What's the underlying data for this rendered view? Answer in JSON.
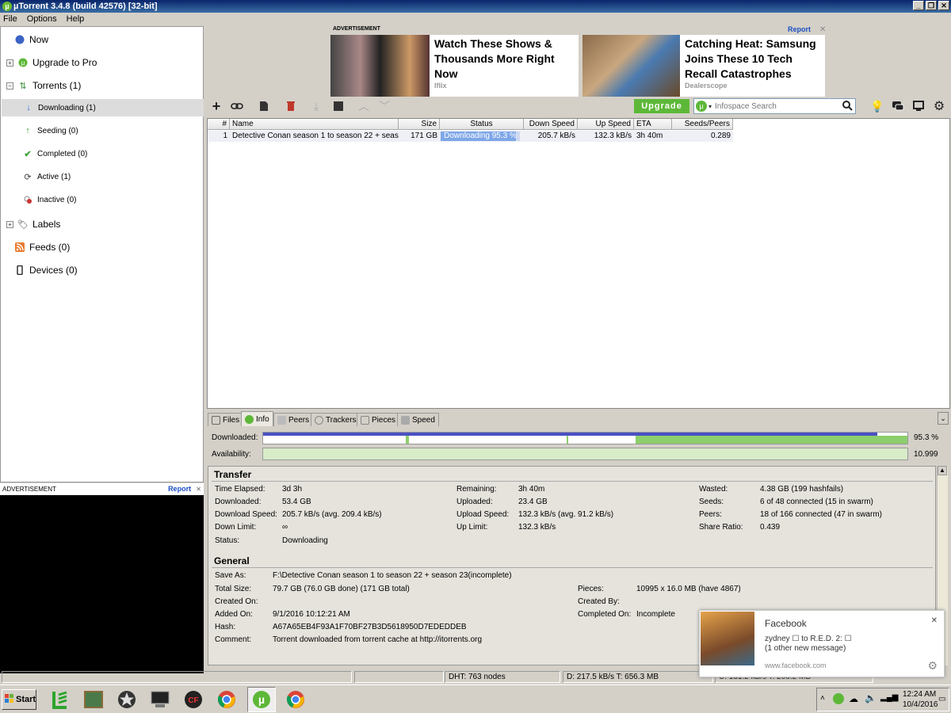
{
  "window": {
    "title": "µTorrent 3.4.8  (build 42576) [32-bit]",
    "min": "_",
    "max": "❐",
    "close": "✕"
  },
  "menu": [
    "File",
    "Options",
    "Help"
  ],
  "sidebar": {
    "now": "Now",
    "upgrade": "Upgrade to Pro",
    "torrents": "Torrents (1)",
    "downloading": "Downloading (1)",
    "seeding": "Seeding (0)",
    "completed": "Completed (0)",
    "active": "Active (1)",
    "inactive": "Inactive (0)",
    "labels": "Labels",
    "feeds": "Feeds (0)",
    "devices": "Devices (0)"
  },
  "ads": {
    "label": "ADVERTISEMENT",
    "report": "Report",
    "close": "✕",
    "ad1_title": "Watch These Shows & Thousands More Right Now",
    "ad1_source": "Iflix",
    "ad2_title": "Catching Heat: Samsung Joins These 10 Tech Recall Catastrophes",
    "ad2_source": "Dealerscope"
  },
  "toolbar": {
    "upgrade": "Upgrade",
    "search_placeholder": "Infospace Search"
  },
  "list": {
    "headers": {
      "num": "#",
      "name": "Name",
      "size": "Size",
      "status": "Status",
      "down": "Down Speed",
      "up": "Up Speed",
      "eta": "ETA",
      "seeds": "Seeds/Peers"
    },
    "row": {
      "num": "1",
      "name": "Detective Conan season 1 to season 22 + seas...",
      "size": "171 GB",
      "status": "Downloading 95.3 %",
      "progress": 0.953,
      "down": "205.7 kB/s",
      "up": "132.3 kB/s",
      "eta": "3h 40m",
      "seeds": "0.289"
    }
  },
  "tabs": [
    "Files",
    "Info",
    "Peers",
    "Trackers",
    "Pieces",
    "Speed"
  ],
  "bars": {
    "downloaded_label": "Downloaded:",
    "downloaded_value": "95.3 %",
    "availability_label": "Availability:",
    "availability_value": "10.999"
  },
  "transfer": {
    "heading": "Transfer",
    "time_elapsed_l": "Time Elapsed:",
    "time_elapsed": "3d 3h",
    "downloaded_l": "Downloaded:",
    "downloaded": "53.4 GB",
    "down_speed_l": "Download Speed:",
    "down_speed": "205.7 kB/s (avg. 209.4 kB/s)",
    "down_limit_l": "Down Limit:",
    "down_limit": "∞",
    "status_l": "Status:",
    "status": "Downloading",
    "remaining_l": "Remaining:",
    "remaining": "3h 40m",
    "uploaded_l": "Uploaded:",
    "uploaded": "23.4 GB",
    "up_speed_l": "Upload Speed:",
    "up_speed": "132.3 kB/s (avg. 91.2 kB/s)",
    "up_limit_l": "Up Limit:",
    "up_limit": "132.3 kB/s",
    "wasted_l": "Wasted:",
    "wasted": "4.38 GB (199 hashfails)",
    "seeds_l": "Seeds:",
    "seeds": "6 of 48 connected (15 in swarm)",
    "peers_l": "Peers:",
    "peers": "18 of 166 connected (47 in swarm)",
    "ratio_l": "Share Ratio:",
    "ratio": "0.439"
  },
  "general": {
    "heading": "General",
    "save_as_l": "Save As:",
    "save_as": "F:\\Detective Conan season 1 to season 22 + season 23(incomplete)",
    "total_size_l": "Total Size:",
    "total_size": "79.7 GB (76.0 GB done) (171 GB total)",
    "created_on_l": "Created On:",
    "added_on_l": "Added On:",
    "added_on": "9/1/2016 10:12:21 AM",
    "hash_l": "Hash:",
    "hash": "A67A65EB4F93A1F70BF27B3D5618950D7EDEDDEB",
    "comment_l": "Comment:",
    "comment": "Torrent downloaded from torrent cache at http://itorrents.org",
    "pieces_l": "Pieces:",
    "pieces": "10995 x 16.0 MB (have 4867)",
    "created_by_l": "Created By:",
    "completed_on_l": "Completed On:",
    "completed_on": "Incomplete"
  },
  "statusbar": {
    "dht": "DHT: 763 nodes",
    "down": "D: 217.5 kB/s T: 656.3 MB",
    "up": "U: 131.2 kB/s T: 200.2 MB"
  },
  "toast": {
    "title": "Facebook",
    "line1": "zydney ☐ to R.E.D. 2: ☐",
    "line2": "(1 other new message)",
    "link": "www.facebook.com",
    "close": "✕"
  },
  "taskbar": {
    "start": "Start",
    "time": "12:24 AM",
    "date": "10/4/2016"
  }
}
